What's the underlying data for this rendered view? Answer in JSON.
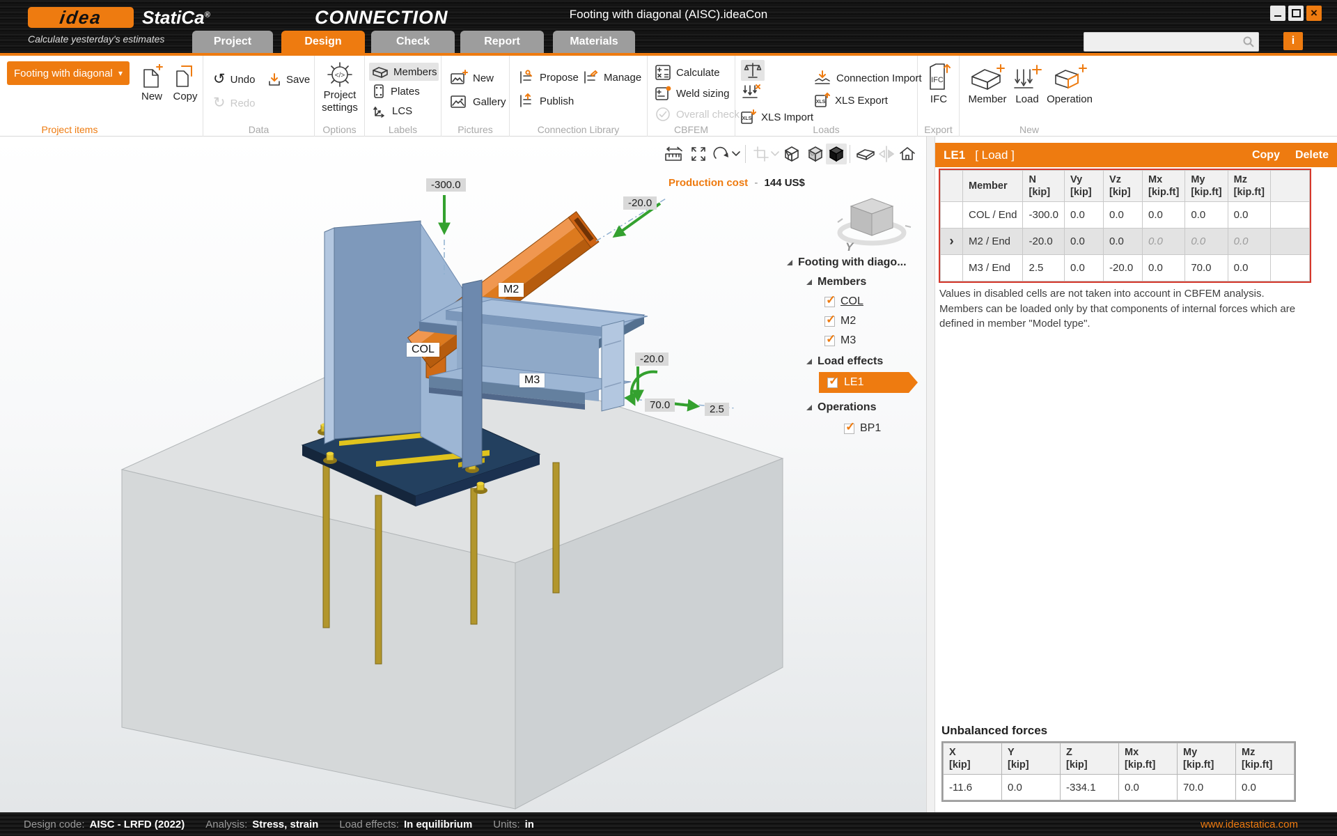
{
  "titlebar": {
    "logo_text": "idea",
    "brand": "StatiCa",
    "brand_reg": "®",
    "product": "CONNECTION",
    "tagline": "Calculate yesterday's estimates",
    "window_title": "Footing with diagonal (AISC).ideaCon"
  },
  "tabs": [
    {
      "label": "Project"
    },
    {
      "label": "Design"
    },
    {
      "label": "Check"
    },
    {
      "label": "Report"
    },
    {
      "label": "Materials"
    }
  ],
  "ribbon": {
    "project_items": {
      "group": "Project items",
      "selector": "Footing with diagonal",
      "new": "New",
      "copy": "Copy"
    },
    "data": {
      "group": "Data",
      "undo": "Undo",
      "redo": "Redo",
      "save": "Save"
    },
    "options": {
      "group": "Options",
      "settings_line1": "Project",
      "settings_line2": "settings"
    },
    "labels": {
      "group": "Labels",
      "members": "Members",
      "plates": "Plates",
      "lcs": "LCS"
    },
    "pictures": {
      "group": "Pictures",
      "new": "New",
      "gallery": "Gallery"
    },
    "library": {
      "group": "Connection Library",
      "propose": "Propose",
      "manage": "Manage",
      "publish": "Publish"
    },
    "cbfem": {
      "group": "CBFEM",
      "calculate": "Calculate",
      "weld": "Weld sizing",
      "overall": "Overall check"
    },
    "loads": {
      "group": "Loads",
      "conn_import": "Connection Import",
      "xls_export": "XLS Export",
      "xls_import": "XLS Import"
    },
    "export": {
      "group": "Export",
      "ifc": "IFC"
    },
    "new": {
      "group": "New",
      "member": "Member",
      "load": "Load",
      "operation": "Operation"
    }
  },
  "viewport": {
    "production_cost_label": "Production cost",
    "production_cost_sep": "-",
    "production_cost_value": "144 US$",
    "nav_axis": "Y",
    "labels": {
      "col": "COL",
      "m2": "M2",
      "m3": "M3"
    },
    "loads": {
      "col_n": "-300.0",
      "m2_n": "-20.0",
      "m3_vz": "-20.0",
      "m3_my": "70.0",
      "m3_n": "2.5"
    }
  },
  "tree": {
    "root": "Footing with diago...",
    "members": "Members",
    "member_items": [
      "COL",
      "M2",
      "M3"
    ],
    "load_effects": "Load effects",
    "load_items": [
      "LE1"
    ],
    "operations": "Operations",
    "operation_items": [
      "BP1"
    ]
  },
  "panel": {
    "title": "LE1",
    "subtitle": "[ Load ]",
    "copy": "Copy",
    "delete": "Delete",
    "forces_table": {
      "headers": [
        [
          "Member",
          ""
        ],
        [
          "N",
          "[kip]"
        ],
        [
          "Vy",
          "[kip]"
        ],
        [
          "Vz",
          "[kip]"
        ],
        [
          "Mx",
          "[kip.ft]"
        ],
        [
          "My",
          "[kip.ft]"
        ],
        [
          "Mz",
          "[kip.ft]"
        ]
      ],
      "rows": [
        {
          "member": "COL / End",
          "values": [
            "-300.0",
            "0.0",
            "0.0",
            "0.0",
            "0.0",
            "0.0"
          ],
          "selected": false,
          "disabled": []
        },
        {
          "member": "M2 / End",
          "values": [
            "-20.0",
            "0.0",
            "0.0",
            "0.0",
            "0.0",
            "0.0"
          ],
          "selected": true,
          "disabled": [
            3,
            4,
            5
          ]
        },
        {
          "member": "M3 / End",
          "values": [
            "2.5",
            "0.0",
            "-20.0",
            "0.0",
            "70.0",
            "0.0"
          ],
          "selected": false,
          "disabled": []
        }
      ]
    },
    "note": "Values in disabled cells are not taken into account in CBFEM analysis. Members can be loaded only by that components of internal forces which are defined in member \"Model type\".",
    "unbalanced": {
      "title": "Unbalanced forces",
      "headers": [
        [
          "X",
          "[kip]"
        ],
        [
          "Y",
          "[kip]"
        ],
        [
          "Z",
          "[kip]"
        ],
        [
          "Mx",
          "[kip.ft]"
        ],
        [
          "My",
          "[kip.ft]"
        ],
        [
          "Mz",
          "[kip.ft]"
        ]
      ],
      "values": [
        "-11.6",
        "0.0",
        "-334.1",
        "0.0",
        "70.0",
        "0.0"
      ]
    }
  },
  "statusbar": {
    "design_code_label": "Design code:",
    "design_code": "AISC - LRFD (2022)",
    "analysis_label": "Analysis:",
    "analysis": "Stress, strain",
    "load_effects_label": "Load effects:",
    "load_effects": "In equilibrium",
    "units_label": "Units:",
    "units": "in",
    "website": "www.ideastatica.com"
  },
  "colors": {
    "accent": "#ee7b10",
    "table_frame": "#d5382c",
    "arrow_green": "#34a12f",
    "member_steel": "#8fa9c8",
    "member_orange": "#dd7a1e",
    "plate_navy": "#23405f",
    "anchor_yellow": "#d9bd2b",
    "concrete": "#dfe1e2"
  }
}
